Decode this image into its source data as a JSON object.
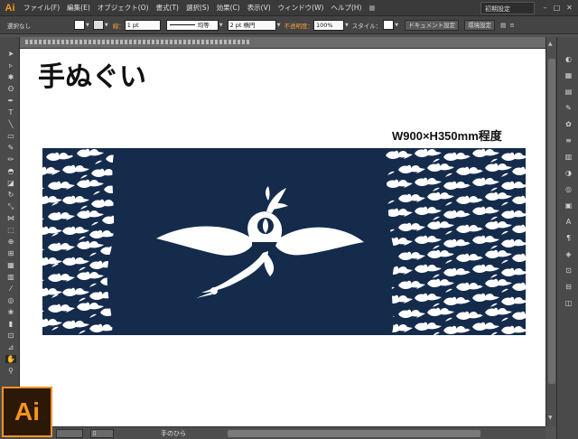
{
  "app": {
    "name": "Ai",
    "workspace": "初期設定"
  },
  "menu": [
    "ファイル(F)",
    "編集(E)",
    "オブジェクト(O)",
    "書式(T)",
    "選択(S)",
    "効果(C)",
    "表示(V)",
    "ウィンドウ(W)",
    "ヘルプ(H)"
  ],
  "control": {
    "selection": "選択なし",
    "stroke_label": "線：",
    "stroke_value": "1 pt",
    "profile": "均等",
    "brush": "2 pt 楕円",
    "opacity_label": "不透明度：",
    "opacity_value": "100%",
    "style_label": "スタイル：",
    "doc_settings": "ドキュメント設定",
    "preferences": "環境設定"
  },
  "artboard": {
    "title": "手ぬぐい",
    "size": "W900×H350mm程度"
  },
  "status": {
    "tool": "手のひら"
  },
  "colors": {
    "accent": "#f7931e",
    "tenugui": "#142b4c"
  }
}
